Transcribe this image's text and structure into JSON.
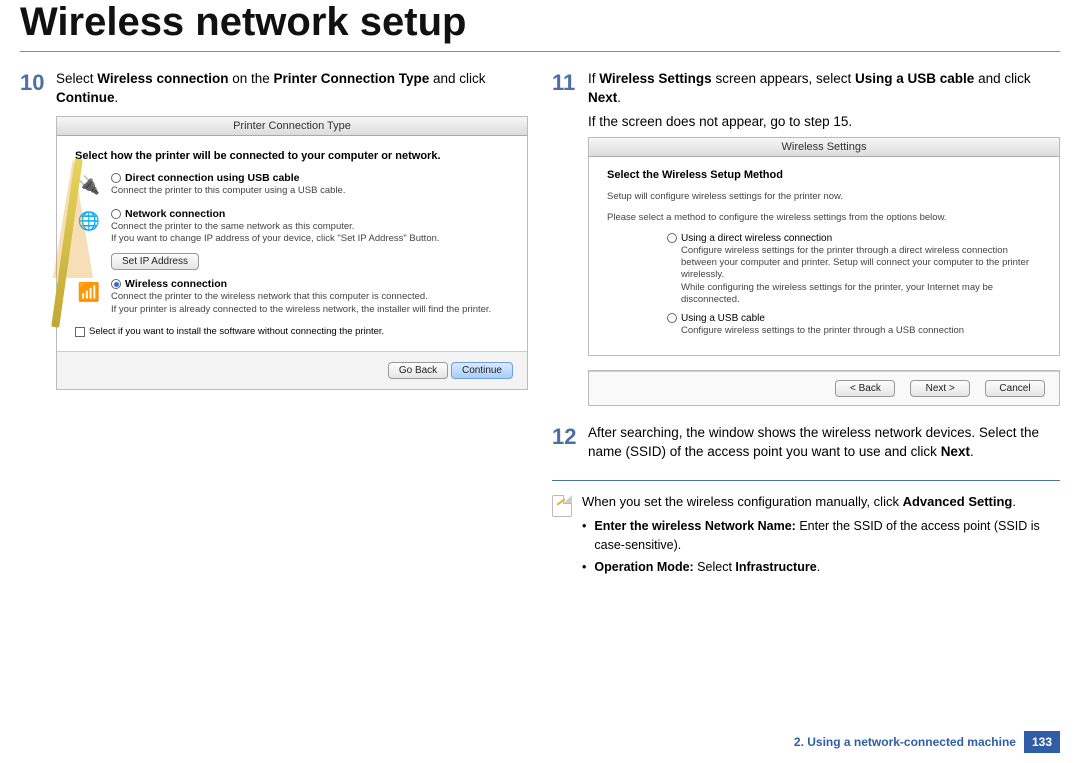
{
  "pageTitle": "Wireless network setup",
  "step10": {
    "num": "10",
    "text_a": "Select ",
    "bold_a": "Wireless connection",
    "text_b": " on the ",
    "bold_b": "Printer Connection Type",
    "text_c": " and click ",
    "bold_c": "Continue",
    "text_d": "."
  },
  "shot10": {
    "title": "Printer Connection Type",
    "heading": "Select how the printer will be connected to your computer or network.",
    "opt1": {
      "label": "Direct connection using USB cable",
      "desc": "Connect the printer to this computer using a USB cable."
    },
    "opt2": {
      "label": "Network connection",
      "desc": "Connect the printer to the same network as this computer.\nIf you want to change IP address of your device, click \"Set IP Address\" Button."
    },
    "ipBtn": "Set IP Address",
    "opt3": {
      "label": "Wireless connection",
      "desc": "Connect the printer to the wireless network that this computer is connected.\nIf your printer is already connected to the wireless network, the installer will find the printer."
    },
    "checkText": "Select if you want to install the software without connecting the printer.",
    "back": "Go Back",
    "cont": "Continue"
  },
  "step11": {
    "num": "11",
    "text_a": "If ",
    "bold_a": "Wireless Settings",
    "text_b": " screen appears, select ",
    "bold_b": "Using a USB cable",
    "text_c": " and click ",
    "bold_c": "Next",
    "text_d": "."
  },
  "step11_note": "If the screen does not appear, go to step 15.",
  "shot11": {
    "title": "Wireless Settings",
    "heading": "Select the Wireless Setup Method",
    "sub1": "Setup will configure wireless settings for the printer now.",
    "sub2": "Please select a method to configure the wireless settings from the options below.",
    "optA": {
      "label": "Using a direct wireless connection",
      "desc": "Configure wireless settings for the printer through a direct wireless connection between your computer and printer. Setup will connect your computer to the printer wirelessly.\nWhile configuring the wireless settings for the printer, your Internet may be disconnected."
    },
    "optB": {
      "label": "Using a USB cable",
      "desc": "Configure wireless settings to the printer through a USB connection"
    },
    "back": "< Back",
    "next": "Next >",
    "cancel": "Cancel"
  },
  "step12": {
    "num": "12",
    "text_a": "After searching, the window shows the wireless network devices. Select the name (SSID) of the access point you want to use and click ",
    "bold_a": "Next",
    "text_b": "."
  },
  "tip": {
    "line1_a": "When you set the wireless configuration manually, click ",
    "line1_b": "Advanced Setting",
    "line1_c": ".",
    "b1_a": "Enter the wireless Network Name:",
    "b1_b": " Enter the SSID of the access point (SSID is case-sensitive).",
    "b2_a": "Operation Mode:",
    "b2_b": " Select ",
    "b2_c": "Infrastructure",
    "b2_d": "."
  },
  "footer": {
    "chapter": "2.  Using a network-connected machine",
    "page": "133"
  }
}
